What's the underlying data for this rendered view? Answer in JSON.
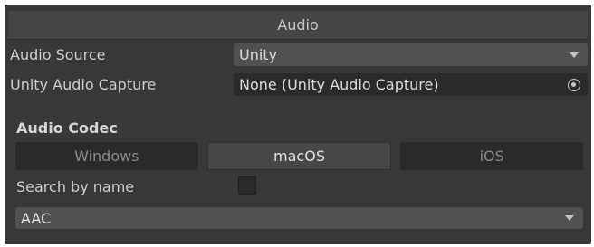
{
  "header": {
    "title": "Audio"
  },
  "audio_source": {
    "label": "Audio Source",
    "value": "Unity"
  },
  "audio_capture": {
    "label": "Unity Audio Capture",
    "value": "None (Unity Audio Capture)"
  },
  "codec": {
    "title": "Audio Codec",
    "tabs": [
      {
        "label": "Windows",
        "active": false
      },
      {
        "label": "macOS",
        "active": true
      },
      {
        "label": "iOS",
        "active": false
      }
    ],
    "search_label": "Search by name",
    "search_checked": false,
    "selected": "AAC"
  },
  "icons": {
    "dropdown": "chevron-down-icon",
    "object_picker": "target-icon"
  }
}
